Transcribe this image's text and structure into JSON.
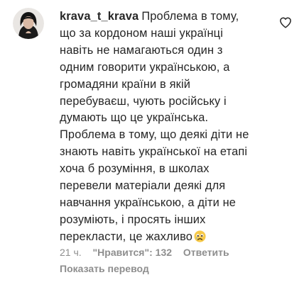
{
  "comment": {
    "username": "krava_t_krava",
    "lines": [
      "Проблема в тому,",
      "що за кордоном наші українці",
      "навіть не намагаються один з",
      "одним говорити українською, а",
      "громадяни країни в якій",
      "перебуваєш, чують російську і",
      "думають що це українська.",
      "Проблема в тому, що деякі діти не",
      "знають навіть української на етапі",
      "хоча б розуміння, в школах",
      "перевели матеріали деякі для",
      "навчання українською, а діти не",
      "розуміють, і просять інших",
      "перекласти, це жахливо"
    ],
    "emoji": "sad-face-emoji",
    "time": "21 ч.",
    "likes": "\"Нравится\": 132",
    "reply_label": "Ответить",
    "translate_label": "Показать перевод",
    "like_icon": "heart-outline-icon"
  }
}
